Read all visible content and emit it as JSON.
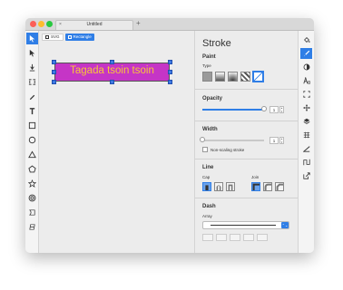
{
  "window": {
    "tab_title": "Untitled",
    "tab_close": "×",
    "tab_add": "+"
  },
  "left_tools": [
    {
      "icon": "pointer-icon",
      "active": true
    },
    {
      "icon": "node-pointer-icon",
      "active": false
    },
    {
      "icon": "text-cursor-icon",
      "active": false
    },
    {
      "icon": "edit-icon",
      "active": false
    },
    {
      "icon": "pen-icon",
      "active": false
    },
    {
      "icon": "text-icon",
      "active": false
    },
    {
      "icon": "rectangle-icon",
      "active": false
    },
    {
      "icon": "circle-icon",
      "active": false
    },
    {
      "icon": "triangle-icon",
      "active": false
    },
    {
      "icon": "pentagon-icon",
      "active": false
    },
    {
      "icon": "star-icon",
      "active": false
    },
    {
      "icon": "ring-icon",
      "active": false
    },
    {
      "icon": "crescent-icon",
      "active": false
    },
    {
      "icon": "freehand-icon",
      "active": false
    }
  ],
  "breadcrumb": {
    "svg_label": "SVG",
    "rect_label": "Rectangle"
  },
  "canvas": {
    "shape_text": "Tagada tsoin tsoin",
    "shape_fill": "#c535c6",
    "text_color": "#f7c53a"
  },
  "panel": {
    "title": "Stroke",
    "paint": {
      "label": "Paint",
      "type_label": "Type"
    },
    "opacity": {
      "label": "Opacity",
      "value": "1",
      "fraction": 1.0
    },
    "width": {
      "label": "Width",
      "value": "1",
      "fraction": 0.0,
      "non_scaling_label": "Non-scaling stroke"
    },
    "line": {
      "label": "Line",
      "cap_label": "Cap",
      "join_label": "Join"
    },
    "dash": {
      "label": "Dash",
      "array_label": "Array"
    }
  },
  "right_tools": [
    {
      "icon": "fill-bucket-icon",
      "active": false
    },
    {
      "icon": "stroke-brush-icon",
      "active": true
    },
    {
      "icon": "contrast-icon",
      "active": false
    },
    {
      "icon": "font-icon",
      "active": false
    },
    {
      "icon": "resize-icon",
      "active": false
    },
    {
      "icon": "move-icon",
      "active": false
    },
    {
      "icon": "layers-icon",
      "active": false
    },
    {
      "icon": "grid-icon",
      "active": false
    },
    {
      "icon": "angle-icon",
      "active": false
    },
    {
      "icon": "path-icon",
      "active": false
    },
    {
      "icon": "export-icon",
      "active": false
    }
  ],
  "colors": {
    "accent": "#2f7ee6",
    "traffic_red": "#fc5f57",
    "traffic_yellow": "#fdbc2e",
    "traffic_green": "#28c840"
  }
}
